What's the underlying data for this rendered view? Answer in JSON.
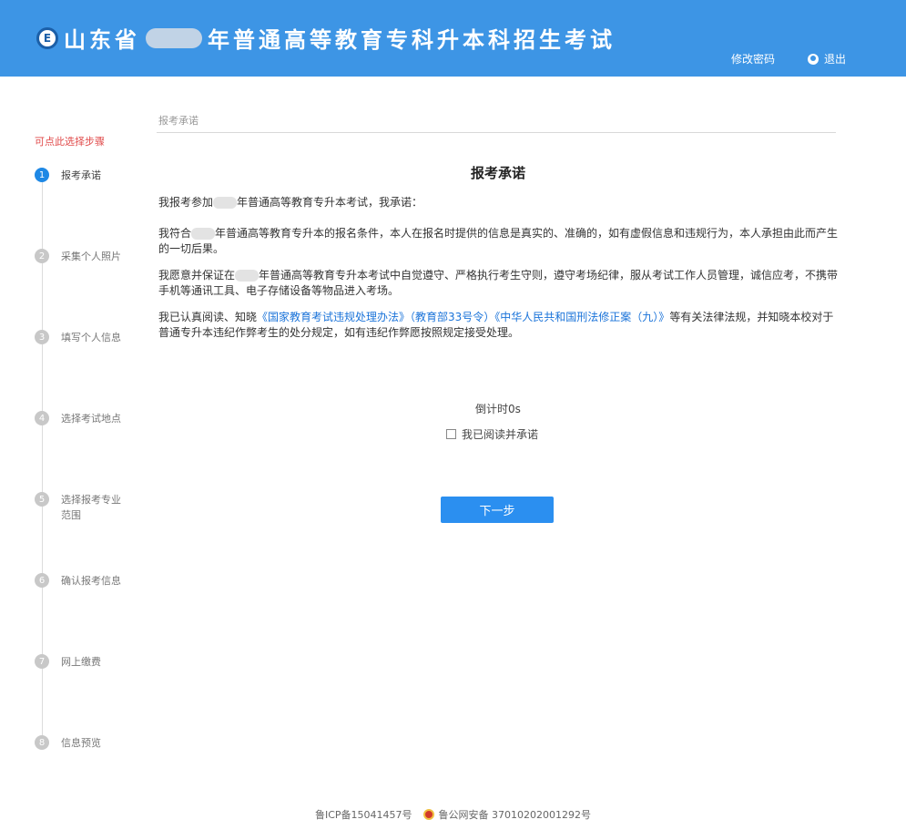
{
  "header": {
    "title_prefix": "山东省",
    "title_suffix": "年普通高等教育专科升本科招生考试",
    "change_password": "修改密码",
    "logout": "退出"
  },
  "sidebar": {
    "hint": "可点此选择步骤",
    "steps": [
      {
        "num": "1",
        "label": "报考承诺"
      },
      {
        "num": "2",
        "label": "采集个人照片"
      },
      {
        "num": "3",
        "label": "填写个人信息"
      },
      {
        "num": "4",
        "label": "选择考试地点"
      },
      {
        "num": "5",
        "label": "选择报考专业范围"
      },
      {
        "num": "6",
        "label": "确认报考信息"
      },
      {
        "num": "7",
        "label": "网上缴费"
      },
      {
        "num": "8",
        "label": "信息预览"
      }
    ]
  },
  "main": {
    "breadcrumb": "报考承诺",
    "title": "报考承诺",
    "p1_a": "我报考参加",
    "p1_b": "年普通高等教育专升本考试，我承诺：",
    "p2_a": "我符合",
    "p2_b": "年普通高等教育专升本的报名条件，本人在报名时提供的信息是真实的、准确的，如有虚假信息和违规行为，本人承担由此而产生的一切后果。",
    "p3_a": "我愿意并保证在",
    "p3_b": "年普通高等教育专升本考试中自觉遵守、严格执行考生守则，遵守考场纪律，服从考试工作人员管理，诚信应考，不携带手机等通讯工具、电子存储设备等物品进入考场。",
    "p4_a": "我已认真阅读、知晓",
    "p4_link1": "《国家教育考试违规处理办法》（教育部33号令）",
    "p4_link2": "《中华人民共和国刑法修正案（九）》",
    "p4_b": "等有关法律法规，并知晓本校对于普通专升本违纪作弊考生的处分规定，如有违纪作弊愿按照规定接受处理。",
    "countdown": "倒计时0s",
    "agree_label": "我已阅读并承诺",
    "next_button": "下一步"
  },
  "footer": {
    "icp": "鲁ICP备15041457号",
    "police": "鲁公网安备 37010202001292号"
  },
  "colors": {
    "header_bg": "#3d95e5",
    "accent": "#2b8ff0",
    "hint": "#e04a4a",
    "link": "#1a73d9"
  }
}
